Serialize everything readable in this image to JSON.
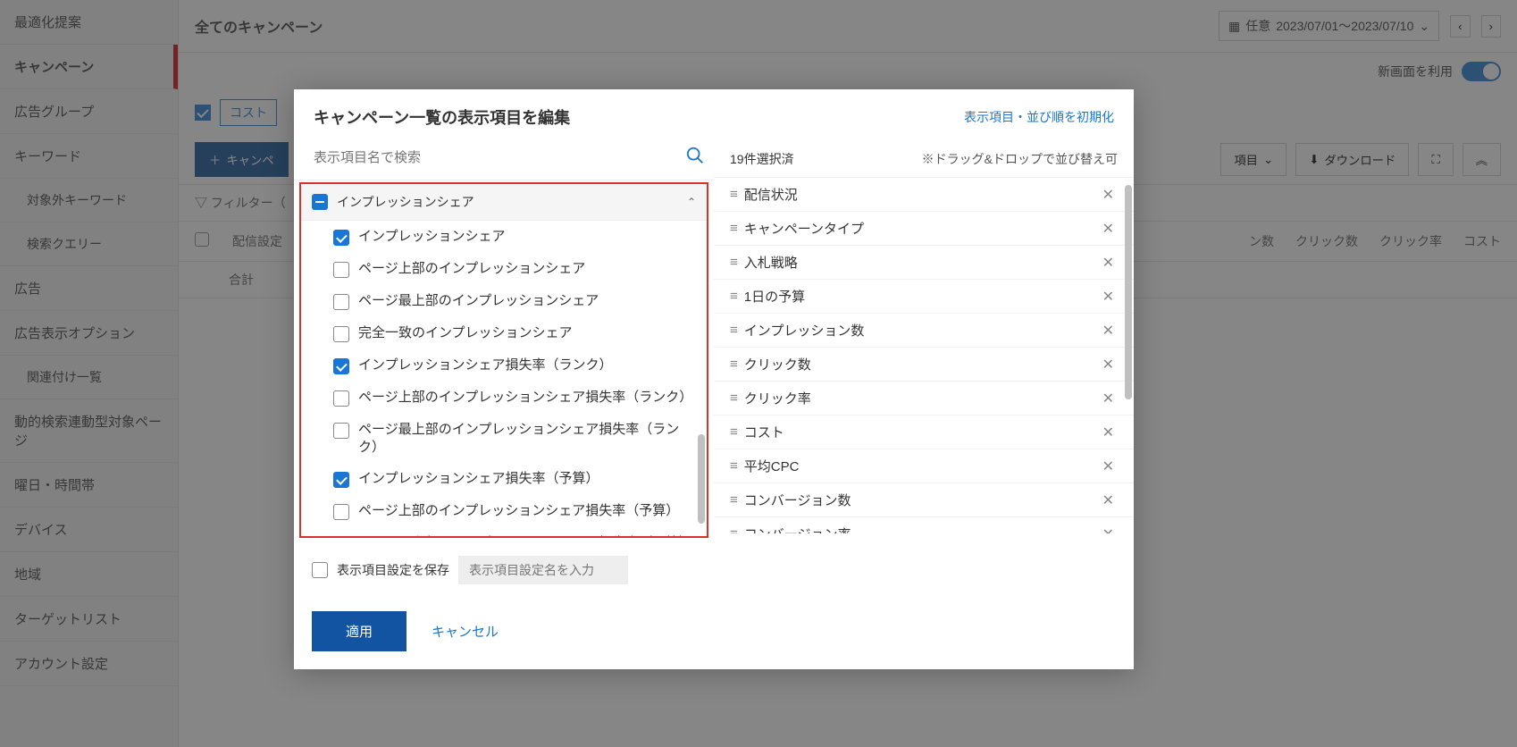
{
  "sidebar": {
    "items": [
      {
        "label": "最適化提案"
      },
      {
        "label": "キャンペーン",
        "active": true
      },
      {
        "label": "広告グループ"
      },
      {
        "label": "キーワード"
      },
      {
        "label": "対象外キーワード",
        "sub": true
      },
      {
        "label": "検索クエリー",
        "sub": true
      },
      {
        "label": "広告"
      },
      {
        "label": "広告表示オプション"
      },
      {
        "label": "関連付け一覧",
        "sub": true
      },
      {
        "label": "動的検索連動型対象ページ"
      },
      {
        "label": "曜日・時間帯"
      },
      {
        "label": "デバイス"
      },
      {
        "label": "地域"
      },
      {
        "label": "ターゲットリスト"
      },
      {
        "label": "アカウント設定"
      }
    ]
  },
  "header": {
    "page_title": "全てのキャンペーン",
    "date_prefix": "任意",
    "date_range": "2023/07/01～2023/07/10",
    "new_ui_label": "新画面を利用"
  },
  "cost_row": {
    "type_label": "コスト"
  },
  "toolbar": {
    "create_btn": "キャンペ",
    "columns_btn": "項目",
    "download_btn": "ダウンロード"
  },
  "filter": {
    "label": "フィルター（"
  },
  "table": {
    "headers": [
      "配信設定",
      "合計",
      "ン数",
      "クリック数",
      "クリック率",
      "コスト"
    ]
  },
  "modal": {
    "title": "キャンペーン一覧の表示項目を編集",
    "reset_link": "表示項目・並び順を初期化",
    "search_placeholder": "表示項目名で検索",
    "category": {
      "name": "インプレッションシェア",
      "items": [
        {
          "label": "インプレッションシェア",
          "checked": true
        },
        {
          "label": "ページ上部のインプレッションシェア",
          "checked": false
        },
        {
          "label": "ページ最上部のインプレッションシェア",
          "checked": false
        },
        {
          "label": "完全一致のインプレッションシェア",
          "checked": false
        },
        {
          "label": "インプレッションシェア損失率（ランク）",
          "checked": true
        },
        {
          "label": "ページ上部のインプレッションシェア損失率（ランク）",
          "checked": false
        },
        {
          "label": "ページ最上部のインプレッションシェア損失率（ランク）",
          "checked": false
        },
        {
          "label": "インプレッションシェア損失率（予算）",
          "checked": true
        },
        {
          "label": "ページ上部のインプレッションシェア損失率（予算）",
          "checked": false
        },
        {
          "label": "ページ最上部のインプレッションシェア損失率（予算）",
          "checked": false
        }
      ]
    },
    "selected": {
      "count_label": "19件選択済",
      "note": "※ドラッグ&ドロップで並び替え可",
      "items": [
        "配信状況",
        "キャンペーンタイプ",
        "入札戦略",
        "1日の予算",
        "インプレッション数",
        "クリック数",
        "クリック率",
        "コスト",
        "平均CPC",
        "コンバージョン数",
        "コンバージョン率"
      ]
    },
    "footer": {
      "save_label": "表示項目設定を保存",
      "save_placeholder": "表示項目設定名を入力",
      "apply": "適用",
      "cancel": "キャンセル"
    }
  }
}
